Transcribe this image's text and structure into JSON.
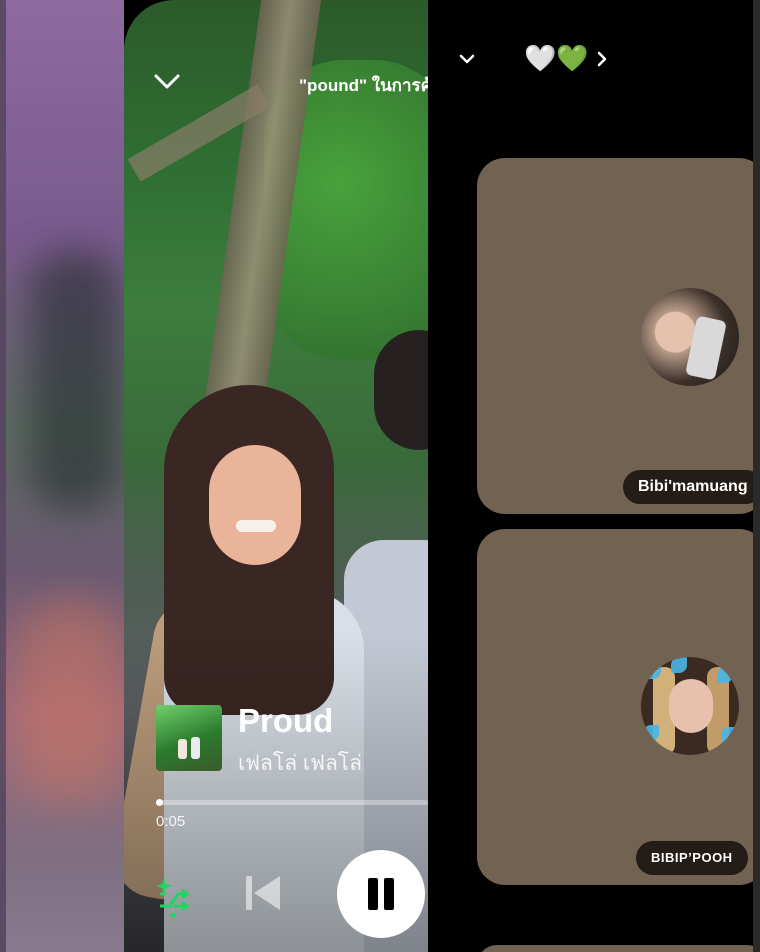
{
  "player": {
    "video_title": "\"pound\" ในการค้",
    "song_title": "Proud",
    "artist": "เฟลโล่ เฟลโล่",
    "elapsed": "0:05",
    "progress": 0.01
  },
  "social": {
    "header_emojis": "🤍💚",
    "profiles": [
      {
        "name": "Bibi'mamuang"
      },
      {
        "name": "BIBIP’POOH"
      }
    ]
  },
  "colors": {
    "accent_green": "#1ed760",
    "tile_background": "#726252"
  },
  "icons": [
    "chevron-down-icon",
    "smart-shuffle-icon",
    "previous-icon",
    "pause-icon",
    "chevron-right-icon"
  ]
}
